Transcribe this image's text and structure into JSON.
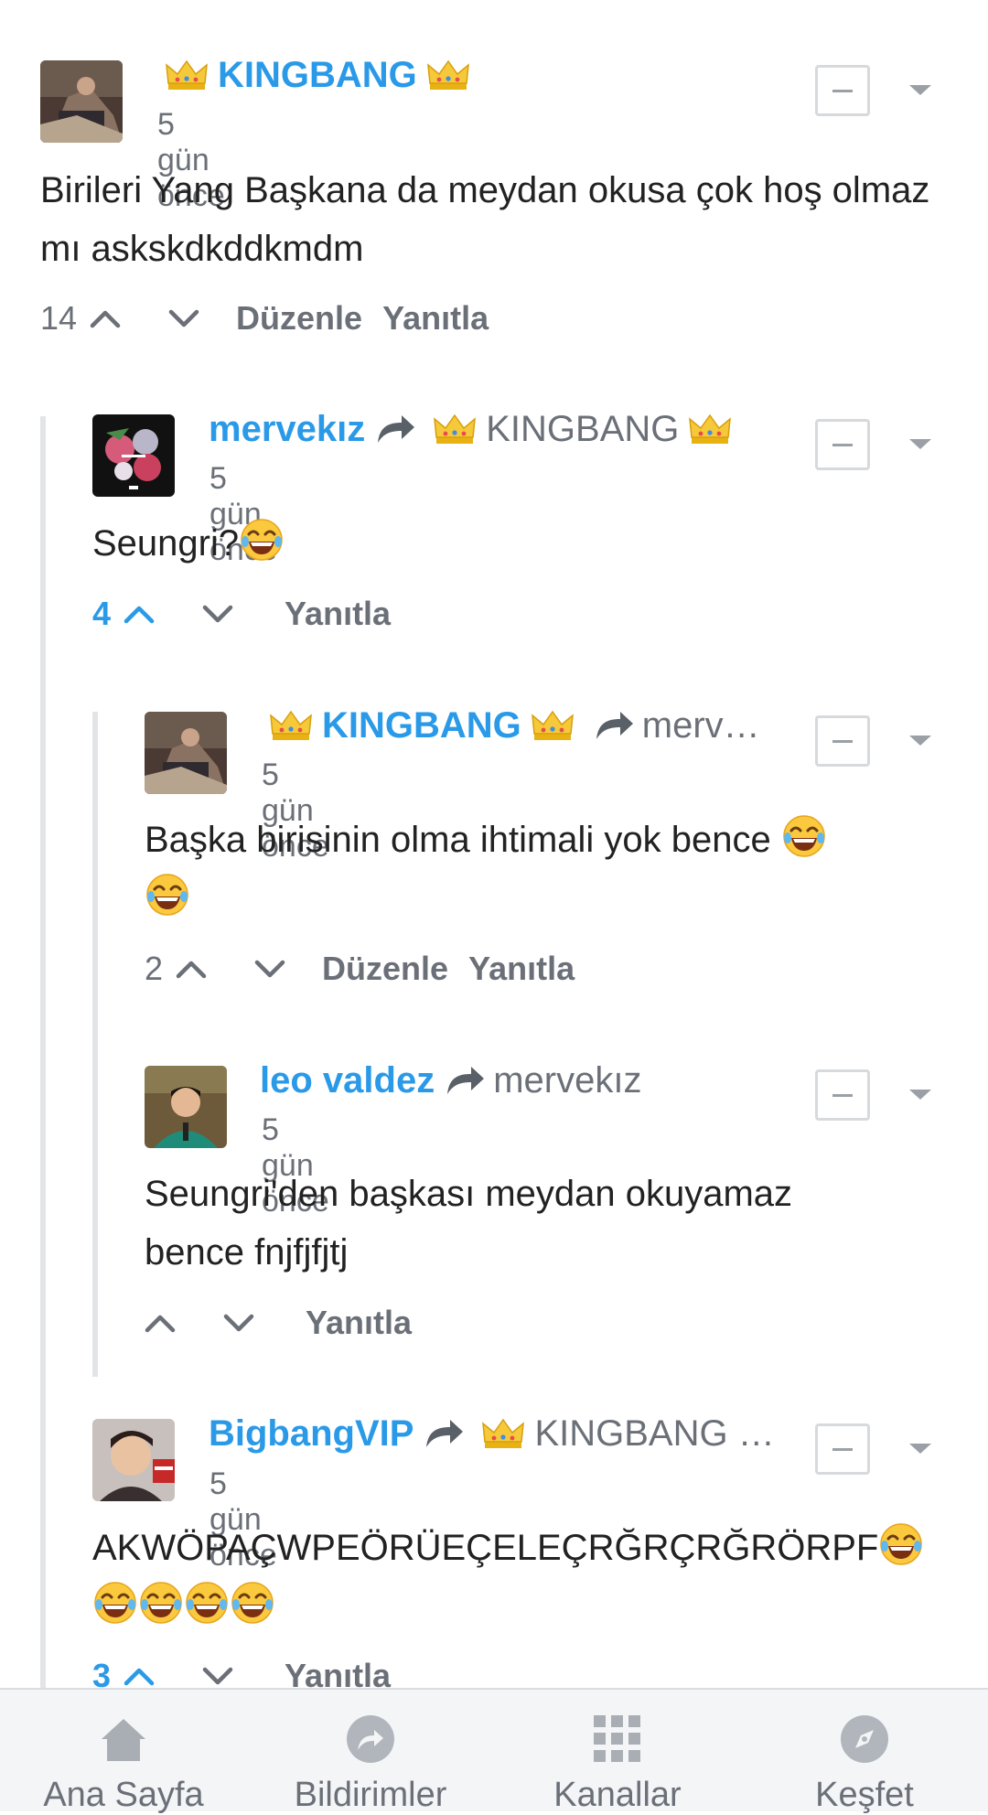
{
  "comments": [
    {
      "author": "KINGBANG",
      "time": "5 gün önce",
      "body": "Birileri Yang Başkana da meydan okusa çok hoş olmaz mı askskdkddkmdm",
      "votes": "14",
      "actions": [
        "Düzenle",
        "Yanıtla"
      ]
    },
    {
      "author": "mervekız",
      "reply_to": "KINGBANG",
      "time": "5 gün önce",
      "body": "Seungri?",
      "votes": "4",
      "actions": [
        "Yanıtla"
      ]
    },
    {
      "author": "KINGBANG",
      "reply_to": "merv…",
      "time": "5 gün önce",
      "body": "Başka birisinin olma ihtimali yok bence ",
      "votes": "2",
      "actions": [
        "Düzenle",
        "Yanıtla"
      ]
    },
    {
      "author": "leo valdez",
      "reply_to": "mervekız",
      "time": "5 gün önce",
      "body_line1": "Seungri'den başkası meydan okuyamaz",
      "body_line2": "bence fnjfjfjtj",
      "votes": "",
      "actions": [
        "Yanıtla"
      ]
    },
    {
      "author": "BigbangVIP",
      "reply_to": "KINGBANG …",
      "time": "5 gün önce",
      "body": "AKWÖPAÇWPEÖRÜEÇELEÇRĞRÇRĞRÖRPF",
      "votes": "3",
      "actions": [
        "Yanıtla"
      ]
    }
  ],
  "nav": {
    "items": [
      {
        "label": "Ana Sayfa",
        "icon": "home-icon"
      },
      {
        "label": "Bildirimler",
        "icon": "share-arrow-icon"
      },
      {
        "label": "Kanallar",
        "icon": "grid-icon"
      },
      {
        "label": "Keşfet",
        "icon": "compass-icon"
      }
    ]
  },
  "colors": {
    "accent": "#2a9ae8",
    "muted": "#6b7078",
    "thread_line": "#e2e4e7",
    "nav_bg": "#f4f5f7"
  }
}
